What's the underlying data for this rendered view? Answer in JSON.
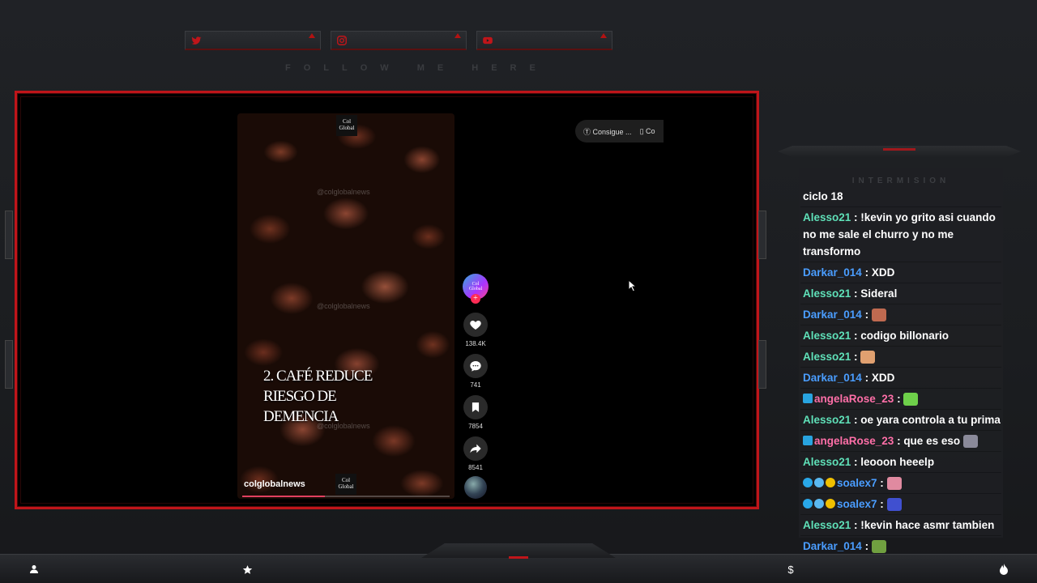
{
  "social": {
    "follow_text": "FOLLOW ME HERE",
    "items": [
      {
        "icon": "twitter-icon",
        "color": "#c0151a"
      },
      {
        "icon": "instagram-icon",
        "color": "#c0151a"
      },
      {
        "icon": "youtube-icon",
        "color": "#c0151a"
      }
    ]
  },
  "video": {
    "logo_text_1": "Col",
    "logo_text_2": "Global",
    "watermark": "@colglobalnews",
    "caption_line_1": "2. CAFÉ REDUCE",
    "caption_line_2": "RIESGO DE",
    "caption_line_3": "DEMENCIA",
    "handle": "colglobalnews",
    "progress_fraction": 0.4
  },
  "actions": {
    "likes": "138.4K",
    "comments": "741",
    "saves": "7854",
    "shares": "8541"
  },
  "top_pill": {
    "label_1": "Consigue ...",
    "label_2": "Co"
  },
  "chat": {
    "header": "INTERMISION",
    "first_line": "ciclo 18",
    "messages": [
      {
        "user": "Alesso21",
        "color": "#5fe0b8",
        "text": "!kevin yo grito asi cuando no me sale el churro y no me transformo"
      },
      {
        "user": "Darkar_014",
        "color": "#4a9dff",
        "text": "XDD"
      },
      {
        "user": "Alesso21",
        "color": "#5fe0b8",
        "text": "Sideral"
      },
      {
        "user": "Darkar_014",
        "color": "#4a9dff",
        "text": "",
        "emote": "#c06a50"
      },
      {
        "user": "Alesso21",
        "color": "#5fe0b8",
        "text": "codigo billonario"
      },
      {
        "user": "Alesso21",
        "color": "#5fe0b8",
        "text": "",
        "emote": "#e0a070"
      },
      {
        "user": "Darkar_014",
        "color": "#4a9dff",
        "text": "XDD"
      },
      {
        "user": "angelaRose_23",
        "color": "#ff6fa8",
        "text": "",
        "emote": "#6ed04a",
        "badge": "#28a4e0"
      },
      {
        "user": "Alesso21",
        "color": "#5fe0b8",
        "text": "oe yara controla a tu prima"
      },
      {
        "user": "angelaRose_23",
        "color": "#ff6fa8",
        "text": "que es eso",
        "emote": "#8a8a9a",
        "badge": "#28a4e0"
      },
      {
        "user": "Alesso21",
        "color": "#5fe0b8",
        "text": "leooon heeelp"
      },
      {
        "user": "soalex7",
        "color": "#4a9dff",
        "text": "",
        "emote": "#e08aa0",
        "badges3": true
      },
      {
        "user": "soalex7",
        "color": "#4a9dff",
        "text": "",
        "emote": "#4050d0",
        "badges3": true
      },
      {
        "user": "Alesso21",
        "color": "#5fe0b8",
        "text": "!kevin hace asmr tambien"
      },
      {
        "user": "Darkar_014",
        "color": "#4a9dff",
        "text": "",
        "emote": "#70a040"
      }
    ]
  },
  "bottom_bar": {
    "icons": [
      "user-icon",
      "star-icon",
      "dollar-icon",
      "flame-icon"
    ],
    "dollar_glyph": "$"
  },
  "colors": {
    "accent_red": "#c0151a",
    "frame_bg": "#000000",
    "page_bg": "#1d1f22"
  }
}
